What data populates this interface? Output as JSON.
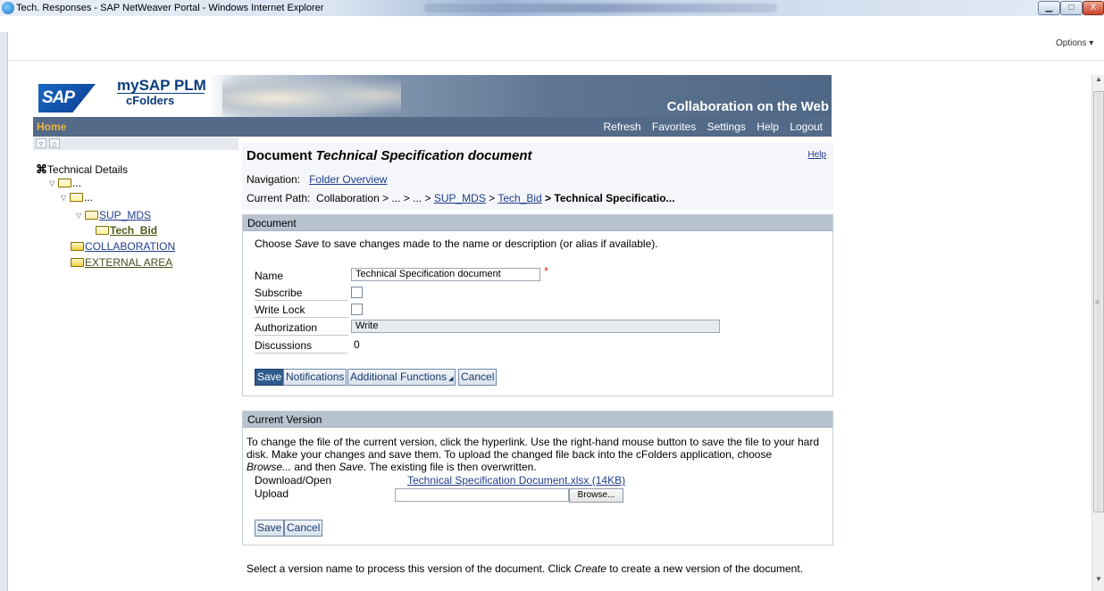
{
  "window": {
    "title": "Tech. Responses - SAP NetWeaver Portal - Windows Internet Explorer",
    "minimize": "▁",
    "maximize": "□",
    "close": "X",
    "options": "Options ▾"
  },
  "header": {
    "logo": "SAP",
    "product_line1": "mySAP PLM",
    "product_line2": "cFolders",
    "tagline": "Collaboration on the Web"
  },
  "nav": {
    "home": "Home",
    "links": [
      "Refresh",
      "Favorites",
      "Settings",
      "Help",
      "Logout"
    ]
  },
  "tree": {
    "toolbar_icons": [
      "collapse-all-icon",
      "home-icon"
    ],
    "collapse_glyph": "▿",
    "home_glyph": "⌂",
    "root": "Technical Details",
    "node_ellipsis": "...",
    "sup_mds": "SUP_MDS",
    "tech_bid": "Tech_Bid",
    "collaboration": "COLLABORATION",
    "external_area": "EXTERNAL AREA"
  },
  "doc": {
    "title_prefix": "Document",
    "title_name": "Technical Specification document",
    "help": "Help",
    "nav_label": "Navigation:",
    "folder_overview": "Folder Overview",
    "path_label": "Current Path:",
    "path_collab": "Collaboration > ... > ... >",
    "path_sup": "SUP_MDS",
    "path_sep": ">",
    "path_tech": "Tech_Bid",
    "path_current": "> Technical Specificatio..."
  },
  "panel_doc": {
    "header": "Document",
    "instructions_pre": "Choose ",
    "instructions_em": "Save",
    "instructions_post": " to save changes made to the name or description (or alias if available).",
    "name_label": "Name",
    "name_value": "Technical Specification document",
    "required": "*",
    "subscribe_label": "Subscribe",
    "writelock_label": "Write Lock",
    "authorization_label": "Authorization",
    "authorization_value": "Write",
    "discussions_label": "Discussions",
    "discussions_value": "0",
    "btn_save": "Save",
    "btn_notifications": "Notifications",
    "btn_additional": "Additional Functions",
    "btn_cancel": "Cancel"
  },
  "panel_ver": {
    "header": "Current Version",
    "text1": "To change the file of the current version, click the hyperlink. Use the right-hand mouse button to save the file to your hard",
    "text2": "disk. Make your changes and save them. To upload the changed file back into the cFolders application, choose",
    "text3_em1": "Browse...",
    "text3_mid": " and then ",
    "text3_em2": "Save",
    "text3_post": ". The existing file is then overwritten.",
    "download_label": "Download/Open",
    "download_link": "Technical Specification Document.xlsx (14KB)",
    "upload_label": "Upload",
    "browse": "Browse...",
    "btn_save": "Save",
    "btn_cancel": "Cancel"
  },
  "footer": {
    "pre": "Select a version name to process this version of the document. Click ",
    "em": "Create",
    "post": " to create a new version of the document."
  }
}
